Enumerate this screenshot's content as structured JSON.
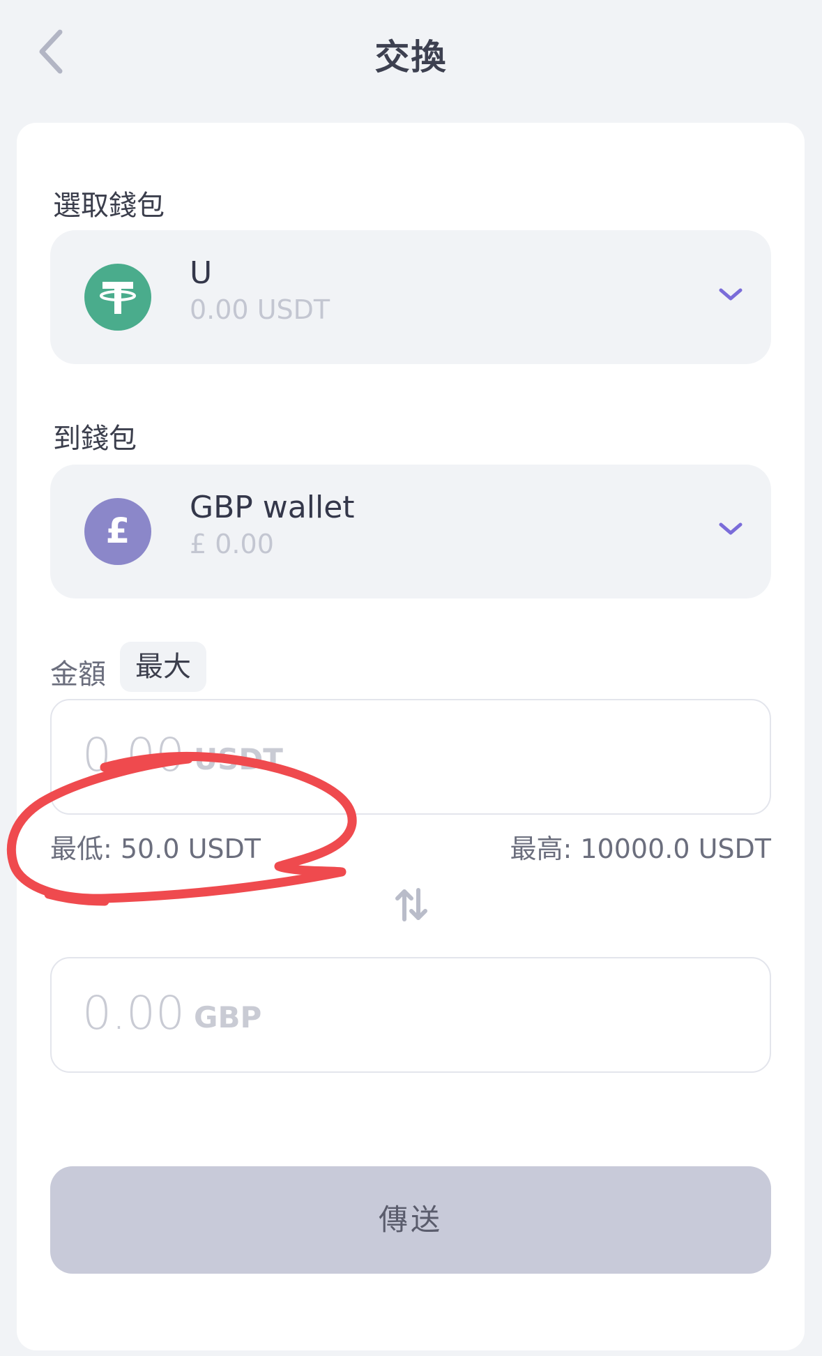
{
  "header": {
    "title": "交換"
  },
  "from_wallet": {
    "label": "選取錢包",
    "name": "U",
    "balance": "0.00 USDT",
    "icon": "tether-icon",
    "icon_color": "#4aac8c"
  },
  "to_wallet": {
    "label": "到錢包",
    "name": "GBP wallet",
    "balance": "£ 0.00",
    "icon": "pound-icon",
    "icon_color": "#8b87c9"
  },
  "amount": {
    "label": "金額",
    "max_label": "最大",
    "input_placeholder_value": "0.00",
    "input_unit": "USDT",
    "min_text": "最低: 50.0 USDT",
    "max_text": "最高: 10000.0 USDT",
    "output_value": "0.00",
    "output_unit": "GBP"
  },
  "send_button": {
    "label": "傳送"
  },
  "colors": {
    "accent_chevron": "#7a6cd9",
    "annotation_red": "#ef4a4e"
  }
}
